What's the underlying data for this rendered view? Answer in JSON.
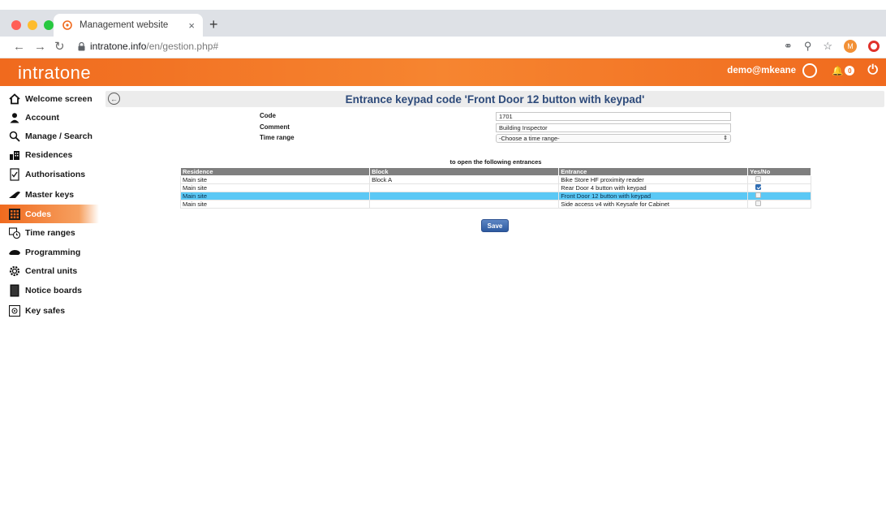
{
  "browser": {
    "tab_title": "Management website",
    "tab_close": "×",
    "new_tab": "+",
    "url_host": "intratone.info",
    "url_path": "/en/gestion.php#",
    "profile_initial": "M"
  },
  "header": {
    "logo": "intratone",
    "user": "demo@mkeane",
    "notification_count": "0"
  },
  "sidebar": {
    "items": [
      {
        "label": "Welcome screen",
        "icon": "home-icon"
      },
      {
        "label": "Account",
        "icon": "user-icon"
      },
      {
        "label": "Manage / Search",
        "icon": "search-icon"
      },
      {
        "label": "Residences",
        "icon": "buildings-icon"
      },
      {
        "label": "Authorisations",
        "icon": "authorisation-icon"
      },
      {
        "label": "Master keys",
        "icon": "key-icon"
      },
      {
        "label": "Codes",
        "icon": "keypad-icon",
        "active": true
      },
      {
        "label": "Time ranges",
        "icon": "clock-icon"
      },
      {
        "label": "Programming",
        "icon": "programming-icon"
      },
      {
        "label": "Central units",
        "icon": "gear-icon"
      },
      {
        "label": "Notice boards",
        "icon": "notice-board-icon"
      },
      {
        "label": "Key safes",
        "icon": "safe-icon"
      }
    ]
  },
  "main": {
    "title": "Entrance keypad code 'Front Door 12 button with keypad'",
    "form": {
      "code_label": "Code",
      "code_value": "1701",
      "comment_label": "Comment",
      "comment_value": "Building Inspector",
      "time_range_label": "Time range",
      "time_range_value": "-Choose a time range-"
    },
    "entrances_caption": "to open the following entrances",
    "table": {
      "headers": [
        "Residence",
        "Block",
        "Entrance",
        "Yes/No"
      ],
      "rows": [
        {
          "residence": "Main site",
          "block": "Block A",
          "entrance": "Bike Store HF proximity reader",
          "checked": false
        },
        {
          "residence": "Main site",
          "block": "",
          "entrance": "Rear Door 4 button with keypad",
          "checked": true
        },
        {
          "residence": "Main site",
          "block": "",
          "entrance": "Front Door 12 button with keypad",
          "checked": false,
          "selected": true
        },
        {
          "residence": "Main site",
          "block": "",
          "entrance": "Side access v4 with Keysafe for Cabinet",
          "checked": false
        }
      ]
    },
    "save_label": "Save"
  },
  "colors": {
    "brand_orange": "#f06a1e",
    "title_blue": "#2d4a7a",
    "selected_row": "#5bc8f5",
    "button_blue": "#2d5aa0"
  }
}
